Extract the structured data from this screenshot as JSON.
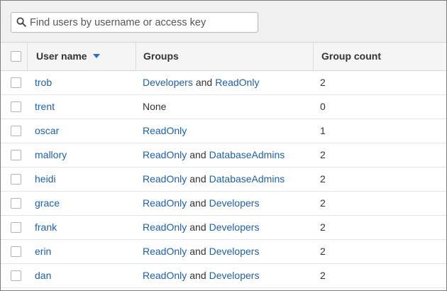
{
  "search": {
    "placeholder": "Find users by username or access key",
    "value": ""
  },
  "table": {
    "headers": {
      "username": "User name",
      "groups": "Groups",
      "group_count": "Group count"
    },
    "sort": {
      "column": "User name",
      "direction": "descending"
    },
    "conjunction": "and",
    "rows": [
      {
        "username": "trob",
        "groups_text": [
          "Developers",
          "ReadOnly"
        ],
        "group_count": "2"
      },
      {
        "username": "trent",
        "groups_text": [],
        "none_label": "None",
        "group_count": "0"
      },
      {
        "username": "oscar",
        "groups_text": [
          "ReadOnly"
        ],
        "group_count": "1"
      },
      {
        "username": "mallory",
        "groups_text": [
          "ReadOnly",
          "DatabaseAdmins"
        ],
        "group_count": "2"
      },
      {
        "username": "heidi",
        "groups_text": [
          "ReadOnly",
          "DatabaseAdmins"
        ],
        "group_count": "2"
      },
      {
        "username": "grace",
        "groups_text": [
          "ReadOnly",
          "Developers"
        ],
        "group_count": "2"
      },
      {
        "username": "frank",
        "groups_text": [
          "ReadOnly",
          "Developers"
        ],
        "group_count": "2"
      },
      {
        "username": "erin",
        "groups_text": [
          "ReadOnly",
          "Developers"
        ],
        "group_count": "2"
      },
      {
        "username": "dan",
        "groups_text": [
          "ReadOnly",
          "Developers"
        ],
        "group_count": "2"
      }
    ]
  },
  "colors": {
    "link": "#1f5fa8",
    "sort_arrow": "#1e72c4",
    "toolbar_bg": "#f0f0f0"
  },
  "icons": {
    "search": "search-icon",
    "sort": "caret-down-icon"
  }
}
